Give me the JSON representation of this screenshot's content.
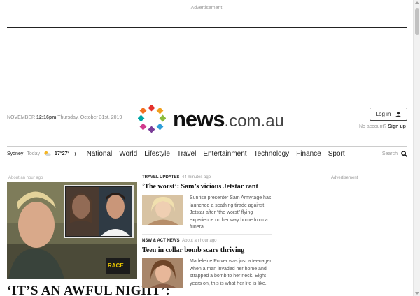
{
  "ads": {
    "top_label": "Advertisement",
    "right_label": "Advertisement"
  },
  "header": {
    "timezone": "November",
    "time": "12:16pm",
    "date": "Thursday, October 31st, 2019",
    "logo_brand": "news",
    "logo_domain": ".com.au",
    "login_label": "Log in",
    "no_account_text": "No account?",
    "signup_label": "Sign up"
  },
  "weather": {
    "city": "Sydney",
    "day": "Today",
    "temp": "17°27°",
    "icon": "partly-sunny-icon"
  },
  "nav": {
    "items": [
      "National",
      "World",
      "Lifestyle",
      "Travel",
      "Entertainment",
      "Technology",
      "Finance",
      "Sport"
    ],
    "search_label": "Search"
  },
  "feature": {
    "timestamp": "About an hour ago",
    "headline": "‘IT’S AN AWFUL NIGHT’:",
    "image_badge": "RACE"
  },
  "stories": [
    {
      "kicker": "Travel Updates",
      "timestamp": "44 minutes ago",
      "title": "‘The worst’: Sam’s vicious Jetstar rant",
      "blurb": "Sunrise presenter Sam Armytage has launched a scathing tirade against Jetstar after “the worst” flying experience on her way home from a funeral."
    },
    {
      "kicker": "NSW & ACT News",
      "timestamp": "About an hour ago",
      "title": "Teen in collar bomb scare thriving",
      "blurb": "Madeleine Pulver was just a teenager when a man invaded her home and strapped a bomb to her neck. Eight years on, this is what her life is like."
    }
  ],
  "colors": {
    "logo_dots": [
      "#e4312b",
      "#f0a020",
      "#8bbb3b",
      "#2e9ed8",
      "#7a3d98",
      "#d13a8c",
      "#00a6a6",
      "#f37021"
    ]
  }
}
